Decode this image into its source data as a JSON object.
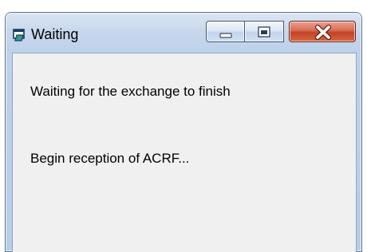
{
  "window": {
    "title": "Waiting",
    "icon": "app-window-icon"
  },
  "controls": {
    "minimize_icon": "minimize-icon",
    "maximize_icon": "maximize-icon",
    "close_icon": "close-icon",
    "close_color": "#c7432a"
  },
  "content": {
    "status_line": "Waiting for the exchange to finish",
    "progress_line": "Begin reception of ACRF..."
  },
  "colors": {
    "client_background": "#f0f0f0",
    "frame": "#bfd2ea"
  }
}
